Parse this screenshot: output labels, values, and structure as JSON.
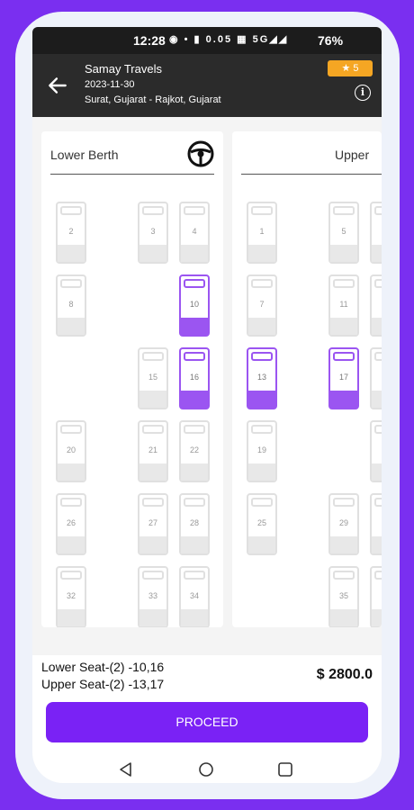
{
  "status_bar": {
    "time": "12:28",
    "icons": "◉ • ▮ 0.05 ▦ 5G◢◢",
    "battery": "76%"
  },
  "header": {
    "back_icon": "arrow-left-icon",
    "operator": "Samay Travels",
    "date": "2023-11-30",
    "route": "Surat, Gujarat - Rajkot, Gujarat",
    "rating": "★ 5",
    "info_icon": "info-icon",
    "info_glyph": "i"
  },
  "decks": {
    "lower": {
      "title": "Lower Berth",
      "steering_icon": "steering-wheel-icon",
      "seats": [
        {
          "label": "2",
          "selected": false
        },
        {
          "label": "3",
          "selected": false
        },
        {
          "label": "4",
          "selected": false
        },
        {
          "label": "8",
          "selected": false
        },
        {
          "label": "10",
          "selected": true
        },
        {
          "label": "15",
          "selected": false
        },
        {
          "label": "16",
          "selected": true
        },
        {
          "label": "20",
          "selected": false
        },
        {
          "label": "21",
          "selected": false
        },
        {
          "label": "22",
          "selected": false
        },
        {
          "label": "26",
          "selected": false
        },
        {
          "label": "27",
          "selected": false
        },
        {
          "label": "28",
          "selected": false
        },
        {
          "label": "32",
          "selected": false
        },
        {
          "label": "33",
          "selected": false
        },
        {
          "label": "34",
          "selected": false
        }
      ]
    },
    "upper": {
      "title": "Upper",
      "seats": [
        {
          "label": "1",
          "selected": false
        },
        {
          "label": "5",
          "selected": false
        },
        {
          "label": "7",
          "selected": false
        },
        {
          "label": "11",
          "selected": false
        },
        {
          "label": "13",
          "selected": true
        },
        {
          "label": "17",
          "selected": true
        },
        {
          "label": "19",
          "selected": false
        },
        {
          "label": "25",
          "selected": false
        },
        {
          "label": "29",
          "selected": false
        },
        {
          "label": "35",
          "selected": false
        },
        {
          "label": "",
          "selected": false
        },
        {
          "label": "",
          "selected": false
        },
        {
          "label": "",
          "selected": false
        },
        {
          "label": "",
          "selected": false
        },
        {
          "label": "",
          "selected": false
        },
        {
          "label": "",
          "selected": false
        }
      ]
    }
  },
  "summary": {
    "lower_seats": "Lower Seat-(2) -10,16",
    "upper_seats": "Upper Seat-(2) -13,17",
    "total": "$ 2800.0"
  },
  "proceed_label": "PROCEED",
  "nav": {
    "back": "nav-back-icon",
    "home": "nav-home-icon",
    "recents": "nav-recents-icon"
  },
  "colors": {
    "accent": "#7a22f5",
    "selected_seat": "#9b55f1",
    "rating_badge": "#f5a623",
    "header_bg": "#2b2b2b"
  }
}
